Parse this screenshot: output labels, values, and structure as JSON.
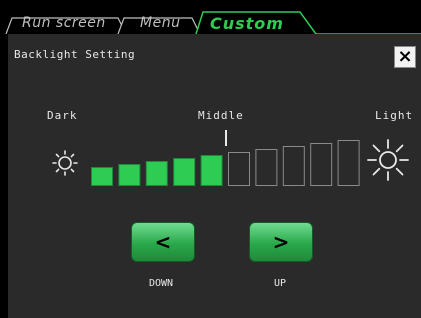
{
  "tabs": [
    {
      "label": "Run screen",
      "active": false
    },
    {
      "label": "Menu",
      "active": false
    },
    {
      "label": "Custom",
      "active": true
    }
  ],
  "panel": {
    "title": "Backlight Setting",
    "close_glyph": "×"
  },
  "backlight": {
    "dark_label": "Dark",
    "middle_label": "Middle",
    "light_label": "Light",
    "level": 5,
    "max_level": 11,
    "dark_icon": "dim-sun-icon",
    "light_icon": "bright-sun-icon"
  },
  "buttons": {
    "down_glyph": "<",
    "down_label": "DOWN",
    "up_glyph": ">",
    "up_label": "UP"
  },
  "colors": {
    "accent": "#2ecc52",
    "panel": "#2a2a2a",
    "inactive_bar_border": "#8a8a8a"
  }
}
